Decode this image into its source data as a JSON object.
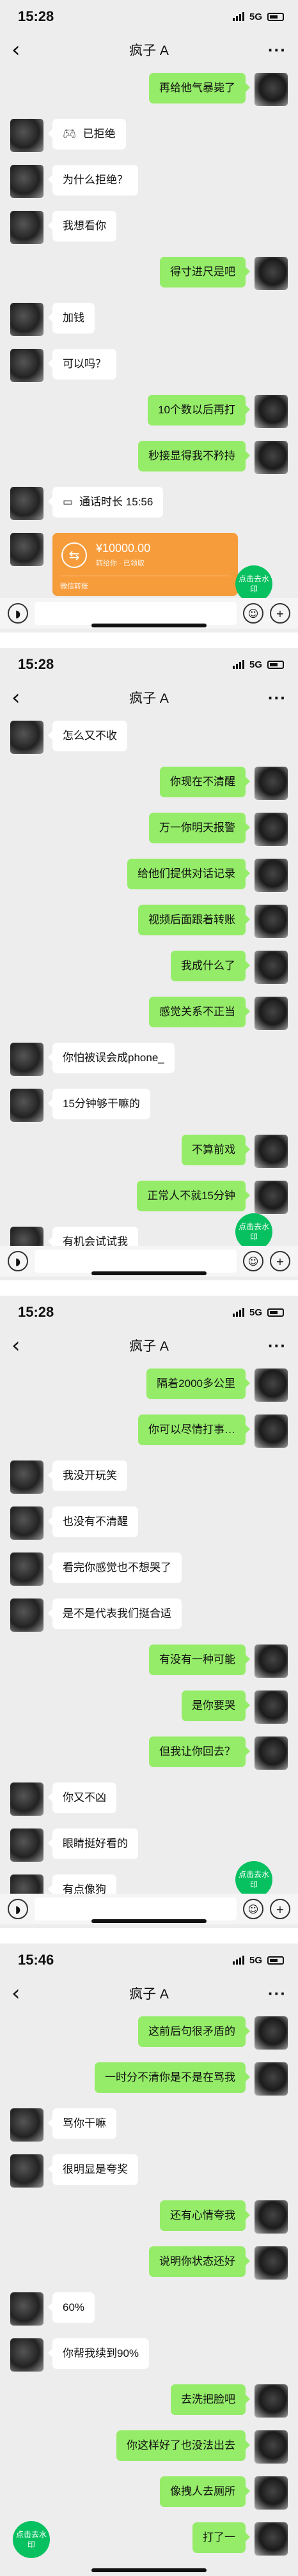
{
  "screens": [
    {
      "time": "15:28",
      "signal": "5G",
      "title": "疯子 A",
      "messages": {
        "m0": {
          "text": "再给他气暴毙了"
        },
        "m1": {
          "text": "已拒绝",
          "icon": "gamepad-icon"
        },
        "m2": {
          "text": "为什么拒绝？"
        },
        "m3": {
          "text": "我想看你"
        },
        "m4": {
          "text": "得寸进尺是吧"
        },
        "m5": {
          "text": "加钱"
        },
        "m6": {
          "text": "可以吗？"
        },
        "m7": {
          "text": "10个数以后再打"
        },
        "m8": {
          "text": "秒接显得我不矜持"
        },
        "m9": {
          "text": "通话时长 15:56",
          "icon": "video-call-icon"
        },
        "t": {
          "amount": "¥10000.00",
          "subtitle": "转给你 · 已领取",
          "label": "微信转账"
        }
      },
      "fab": "点击去水印"
    },
    {
      "time": "15:28",
      "signal": "5G",
      "title": "疯子 A",
      "messages": {
        "m0": {
          "text": "怎么又不收"
        },
        "m1": {
          "text": "你现在不清醒"
        },
        "m2": {
          "text": "万一你明天报警"
        },
        "m3": {
          "text": "给他们提供对话记录"
        },
        "m4": {
          "text": "视频后面跟着转账"
        },
        "m5": {
          "text": "我成什么了"
        },
        "m6": {
          "text": "感觉关系不正当"
        },
        "m7": {
          "text": "你怕被误会成phone_"
        },
        "m8": {
          "text": "15分钟够干嘛的"
        },
        "m9": {
          "text": "不算前戏"
        },
        "m10": {
          "text": "正常人不就15分钟"
        },
        "m11": {
          "text": "有机会试试我"
        }
      },
      "fab": "点击去水印"
    },
    {
      "time": "15:28",
      "signal": "5G",
      "title": "疯子 A",
      "messages": {
        "m0": {
          "text": "隔着2000多公里"
        },
        "m1": {
          "text": "你可以尽情打事…"
        },
        "m2": {
          "text": "我没开玩笑"
        },
        "m3": {
          "text": "也没有不清醒"
        },
        "m4": {
          "text": "看完你感觉也不想哭了"
        },
        "m5": {
          "text": "是不是代表我们挺合适"
        },
        "m6": {
          "text": "有没有一种可能"
        },
        "m7": {
          "text": "是你要哭"
        },
        "m8": {
          "text": "但我让你回去？"
        },
        "m9": {
          "text": "你又不凶"
        },
        "m10": {
          "text": "眼睛挺好看的"
        },
        "m11": {
          "text": "有点像狗"
        }
      },
      "fab": "点击去水印"
    },
    {
      "time": "15:46",
      "signal": "5G",
      "title": "疯子 A",
      "messages": {
        "m0": {
          "text": "这前后句很矛盾的"
        },
        "m1": {
          "text": "一时分不清你是不是在骂我"
        },
        "m2": {
          "text": "骂你干嘛"
        },
        "m3": {
          "text": "很明显是夸奖"
        },
        "m4": {
          "text": "还有心情夸我"
        },
        "m5": {
          "text": "说明你状态还好"
        },
        "m6": {
          "text": "60%"
        },
        "m7": {
          "text": "你帮我续到90%"
        },
        "m8": {
          "text": "去洗把脸吧"
        },
        "m9": {
          "text": "你这样好了也没法出去"
        },
        "m10": {
          "text": "像拽人去厕所"
        },
        "m11": {
          "text": "打了一"
        }
      },
      "fab": "点击去水印"
    }
  ],
  "colors": {
    "bg": "#ededed",
    "me": "#95ec69",
    "other": "#ffffff",
    "transfer": "#f79c3b",
    "fab": "#07c160"
  }
}
